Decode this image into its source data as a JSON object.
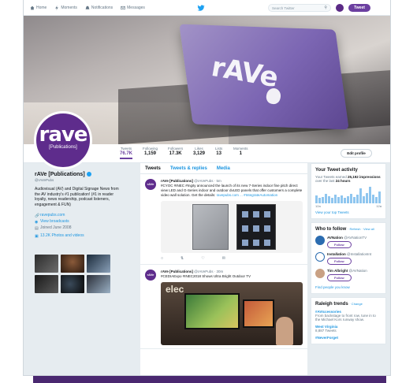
{
  "topnav": {
    "home": "Home",
    "moments": "Moments",
    "notifications": "Notifications",
    "messages": "Messages",
    "search_placeholder": "Search Twitter",
    "tweet_button": "Tweet"
  },
  "banner": {
    "laptop_text": "rAVe"
  },
  "avatar": {
    "logo": "rave",
    "sub": "[Publications]"
  },
  "stats": [
    {
      "label": "Tweets",
      "value": "76.7K"
    },
    {
      "label": "Following",
      "value": "1,159"
    },
    {
      "label": "Followers",
      "value": "17.3K"
    },
    {
      "label": "Likes",
      "value": "3,129"
    },
    {
      "label": "Lists",
      "value": "13"
    },
    {
      "label": "Moments",
      "value": "1"
    }
  ],
  "edit_profile": "Edit profile",
  "profile": {
    "name": "rAVe [Publications]",
    "handle": "@rAVePubs",
    "bio": "Audiovisual (AV) and Digital Signage News from the AV industry's #1 publication! (#1 in reader loyalty, news readership, podcast listeners, engagement & FUN)",
    "website": "ravepubs.com",
    "broadcasts": "View broadcasts",
    "joined": "Joined June 2008",
    "photos": "13.2K Photos and videos"
  },
  "timeline": {
    "tabs": [
      "Tweets",
      "Tweets & replies",
      "Media"
    ],
    "tweets": [
      {
        "avatar": "rAVe",
        "name": "rAVe [Publications]",
        "handle": "@rAVePubs · 5m",
        "text": "#CYOC #INEC #Ingity announced the launch of its new 7-Series indoor fine pitch direct view LED and G-Series indoor and outdoor dvLED panels that offer customers a complete video wall solution. Get the details:",
        "link": "ravepubs.com ... #IntegrateAutomation"
      },
      {
        "avatar": "rAVe",
        "name": "rAVe [Publications]",
        "handle": "@rAVePubs · 30m",
        "text": "#CEDIAExpo #INEC2018 Shows Ultra Bright Outdoor TV",
        "brand": "elec"
      }
    ]
  },
  "activity": {
    "title": "Your Tweet activity",
    "line1": "Your Tweets earned",
    "impressions": "25,192 impressions",
    "line2": "over the last",
    "period": "24 hours",
    "axis_left": "12a",
    "axis_right": "12a",
    "link": "View your top Tweets"
  },
  "who_to_follow": {
    "title": "Who to follow",
    "refresh": "· Refresh · View all",
    "items": [
      {
        "name": "AVNation",
        "handle": "@AVNationTV"
      },
      {
        "name": "Installation",
        "handle": "@InstallationInt"
      },
      {
        "name": "Tim Albright",
        "handle": "@AVNation"
      }
    ],
    "follow": "Follow",
    "find_people": "Find people you know"
  },
  "trends": {
    "title": "Raleigh trends",
    "change": "· Change",
    "items": [
      {
        "name": "#AVIccessories",
        "desc": "From backstage to front row, tune in to the Michael Kors runway show."
      },
      {
        "name": "West Virginia",
        "desc": "8,887 Tweets"
      },
      {
        "name": "#NeverForget",
        "desc": ""
      }
    ]
  },
  "sparkline": [
    0.45,
    0.3,
    0.35,
    0.55,
    0.4,
    0.3,
    0.5,
    0.35,
    0.45,
    0.3,
    0.4,
    0.55,
    0.35,
    0.5,
    0.85,
    0.4,
    0.6,
    0.95,
    0.5,
    0.35,
    0.7
  ],
  "colors": {
    "brand": "#5e2c8c",
    "link": "#1b95e0",
    "accent": "#6b3fa0"
  }
}
